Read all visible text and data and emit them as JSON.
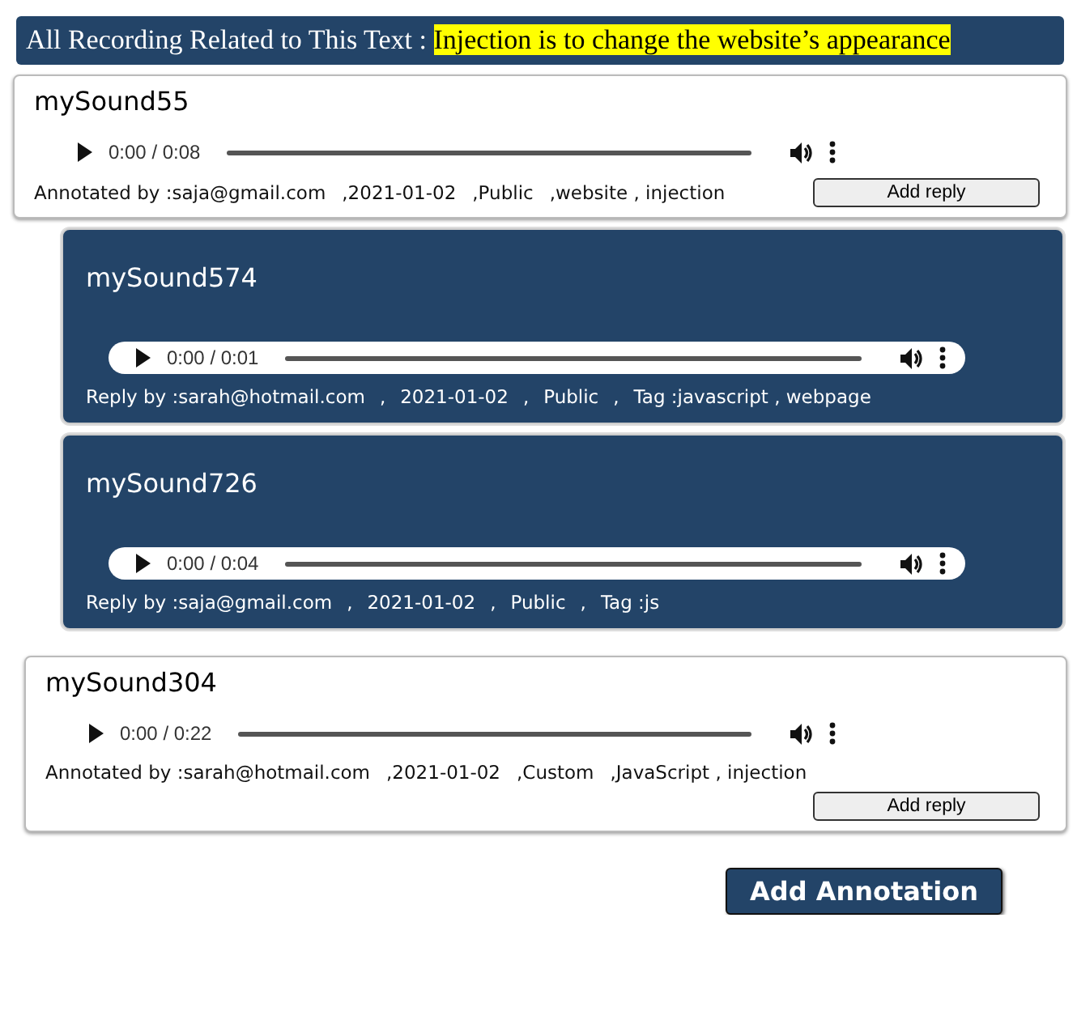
{
  "header": {
    "label": "All Recording Related to This Text :",
    "highlight": "Injection is to change the website’s appearance"
  },
  "recordings": [
    {
      "kind": "annotation",
      "title": "mySound55",
      "time": "0:00 / 0:08",
      "meta": [
        "Annotated by :saja@gmail.com",
        ",2021-01-02",
        ",Public",
        ",website , injection"
      ],
      "button": "Add reply"
    },
    {
      "kind": "reply",
      "title": "mySound574",
      "time": "0:00 / 0:01",
      "meta": [
        "Reply by :sarah@hotmail.com",
        ",",
        "2021-01-02",
        ",",
        "Public",
        ",",
        "Tag :javascript , webpage"
      ]
    },
    {
      "kind": "reply",
      "title": "mySound726",
      "time": "0:00 / 0:04",
      "meta": [
        "Reply by :saja@gmail.com",
        ",",
        "2021-01-02",
        ",",
        "Public",
        ",",
        "Tag :js"
      ]
    },
    {
      "kind": "annotation",
      "title": "mySound304",
      "time": "0:00 / 0:22",
      "meta": [
        "Annotated by :sarah@hotmail.com",
        ",2021-01-02",
        ",Custom",
        ",JavaScript , injection"
      ],
      "button": "Add reply"
    }
  ],
  "add_button": "Add Annotation"
}
